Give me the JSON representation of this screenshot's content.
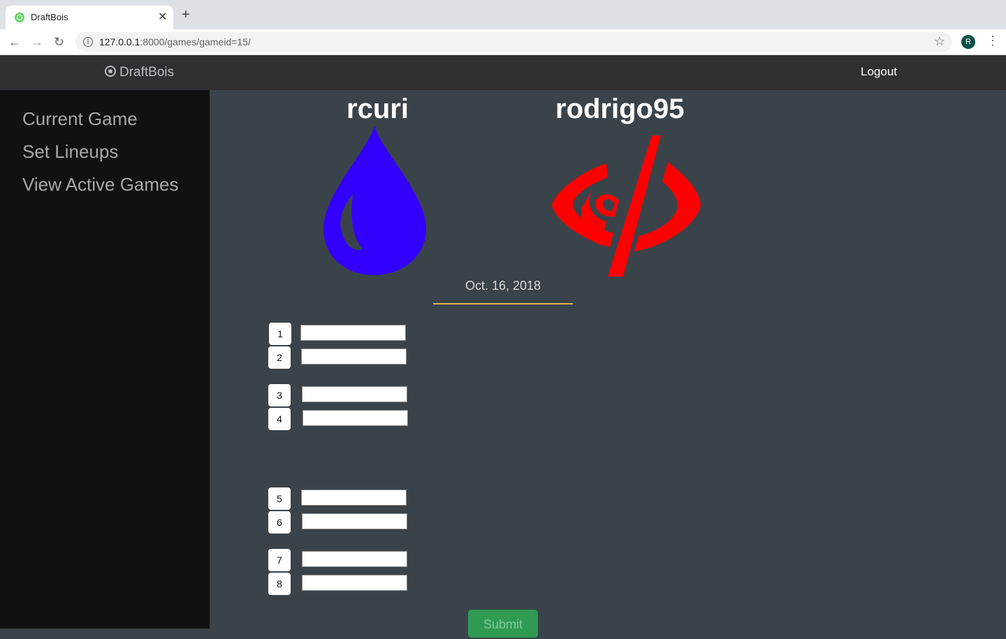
{
  "browser": {
    "tab_title": "DraftBois",
    "url_host": "127.0.0.1",
    "url_rest": ":8000/games/gameid=15/",
    "profile_initial": "R"
  },
  "header": {
    "brand": "DraftBois",
    "logout": "Logout"
  },
  "sidebar": {
    "items": [
      {
        "label": "Current Game"
      },
      {
        "label": "Set Lineups"
      },
      {
        "label": "View Active Games"
      }
    ]
  },
  "game": {
    "players": [
      {
        "name": "rcuri",
        "logo": "water-drop-icon",
        "color": "#3300ff"
      },
      {
        "name": "rodrigo95",
        "logo": "red-eye-slash-icon",
        "color": "#ff0000"
      }
    ],
    "date": "Oct. 16, 2018",
    "slots": [
      "1",
      "2",
      "3",
      "4",
      "5",
      "6",
      "7",
      "8"
    ],
    "submit": "Submit"
  }
}
